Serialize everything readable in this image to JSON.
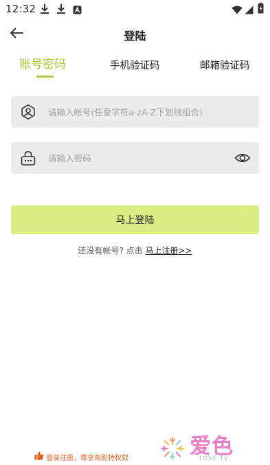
{
  "status_bar": {
    "time": "12:32",
    "icons": [
      "download-icon",
      "download-icon",
      "app-notification-icon",
      "wifi-icon",
      "signal-icon",
      "battery-icon"
    ]
  },
  "header": {
    "title": "登陆",
    "back_icon": "arrow-left-icon"
  },
  "tabs": [
    {
      "label": "账号密码",
      "active": true
    },
    {
      "label": "手机验证码",
      "active": false
    },
    {
      "label": "邮箱验证码",
      "active": false
    }
  ],
  "form": {
    "account": {
      "placeholder": "请输入帐号(任意字符a-zA-Z下划线组合)",
      "value": "",
      "icon": "user-badge-icon"
    },
    "password": {
      "placeholder": "请输入密码",
      "value": "",
      "icon": "lock-icon",
      "toggle_icon": "eye-icon"
    },
    "submit_label": "马上登陆"
  },
  "register": {
    "prompt": "还没有帐号? 点击 ",
    "link": "马上注册>>"
  },
  "footer": {
    "note": "登录注册，尊享观影特权奴",
    "brand_name": "爱色",
    "brand_sub": "LOVE TV"
  },
  "colors": {
    "accent": "#a8cc3a",
    "button_bg": "#d8ee85",
    "input_bg": "#ececec",
    "footer_note": "#e0621f",
    "brand": "#e981c9"
  }
}
